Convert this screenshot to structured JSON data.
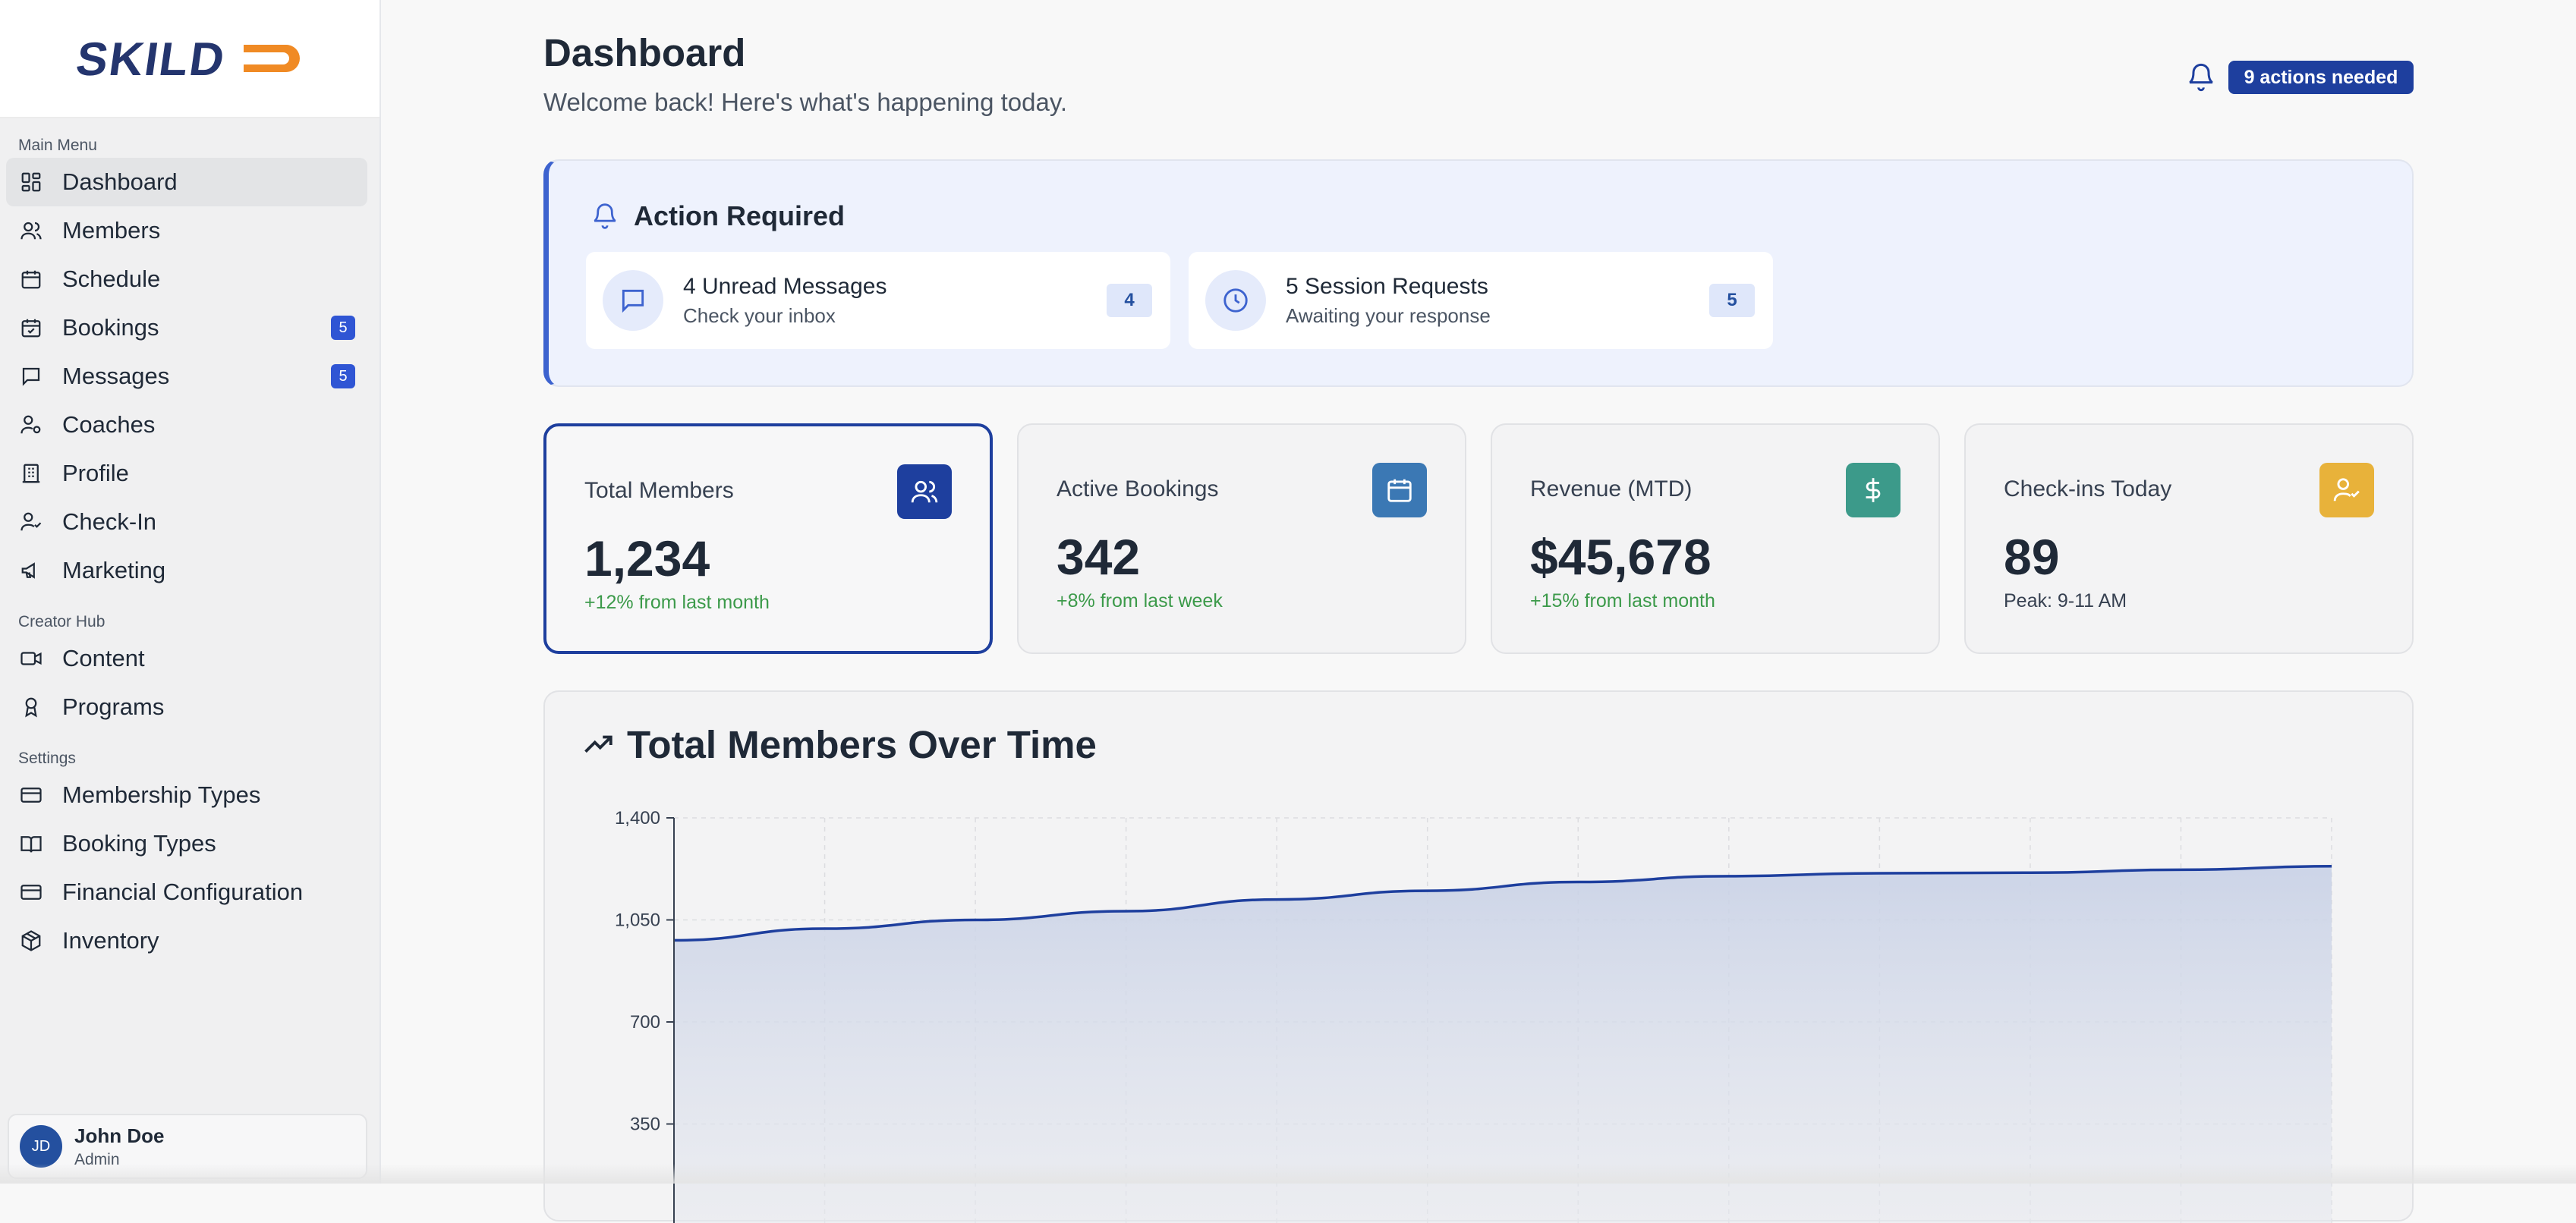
{
  "brand": {
    "logo_text": "SKILD",
    "accent": "#f08a24",
    "primary": "#24356e"
  },
  "sidebar": {
    "sections": [
      {
        "label": "Main Menu"
      },
      {
        "label": "Creator Hub"
      },
      {
        "label": "Settings"
      }
    ],
    "main_items": [
      {
        "label": "Dashboard",
        "icon": "dashboard-icon",
        "active": true
      },
      {
        "label": "Members",
        "icon": "users-icon"
      },
      {
        "label": "Schedule",
        "icon": "calendar-icon"
      },
      {
        "label": "Bookings",
        "icon": "calendar-check-icon",
        "badge": "5"
      },
      {
        "label": "Messages",
        "icon": "message-icon",
        "badge": "5"
      },
      {
        "label": "Coaches",
        "icon": "coach-icon"
      },
      {
        "label": "Profile",
        "icon": "building-icon"
      },
      {
        "label": "Check-In",
        "icon": "user-check-icon"
      },
      {
        "label": "Marketing",
        "icon": "megaphone-icon"
      }
    ],
    "creator_items": [
      {
        "label": "Content",
        "icon": "video-icon"
      },
      {
        "label": "Programs",
        "icon": "award-icon"
      }
    ],
    "settings_items": [
      {
        "label": "Membership Types",
        "icon": "card-icon"
      },
      {
        "label": "Booking Types",
        "icon": "book-icon"
      },
      {
        "label": "Financial Configuration",
        "icon": "card-icon"
      },
      {
        "label": "Inventory",
        "icon": "package-icon"
      }
    ],
    "user": {
      "initials": "JD",
      "name": "John Doe",
      "role": "Admin"
    }
  },
  "header": {
    "title": "Dashboard",
    "subtitle": "Welcome back! Here's what's happening today.",
    "actions_badge": "9 actions needed"
  },
  "action_required": {
    "title": "Action Required",
    "cards": [
      {
        "title": "4 Unread Messages",
        "subtitle": "Check your inbox",
        "count": "4",
        "icon": "message-icon"
      },
      {
        "title": "5 Session Requests",
        "subtitle": "Awaiting your response",
        "count": "5",
        "icon": "clock-icon"
      }
    ]
  },
  "stats": [
    {
      "label": "Total Members",
      "value": "1,234",
      "delta": "+12% from last month",
      "icon": "users-icon",
      "color": "#1e3f9e",
      "selected": true
    },
    {
      "label": "Active Bookings",
      "value": "342",
      "delta": "+8% from last week",
      "icon": "calendar-icon",
      "color": "#3b78b4"
    },
    {
      "label": "Revenue (MTD)",
      "value": "$45,678",
      "delta": "+15% from last month",
      "icon": "dollar-icon",
      "color": "#3c9a8a"
    },
    {
      "label": "Check-ins Today",
      "value": "89",
      "delta": "Peak: 9-11 AM",
      "icon": "user-check-icon",
      "color": "#e8b23a"
    }
  ],
  "chart_data": {
    "type": "area",
    "title": "Total Members Over Time",
    "xlabel": "",
    "ylabel": "",
    "ylim": [
      0,
      1400
    ],
    "yticks": [
      "1,400",
      "1,050",
      "700",
      "350"
    ],
    "ytick_values": [
      1400,
      1050,
      700,
      350
    ],
    "x": [
      0,
      1,
      2,
      3,
      4,
      5,
      6,
      7,
      8,
      9,
      10,
      11
    ],
    "values": [
      980,
      1020,
      1050,
      1080,
      1120,
      1150,
      1180,
      1200,
      1210,
      1212,
      1222,
      1234
    ],
    "grid": true,
    "line_color": "#1e3f9e"
  }
}
